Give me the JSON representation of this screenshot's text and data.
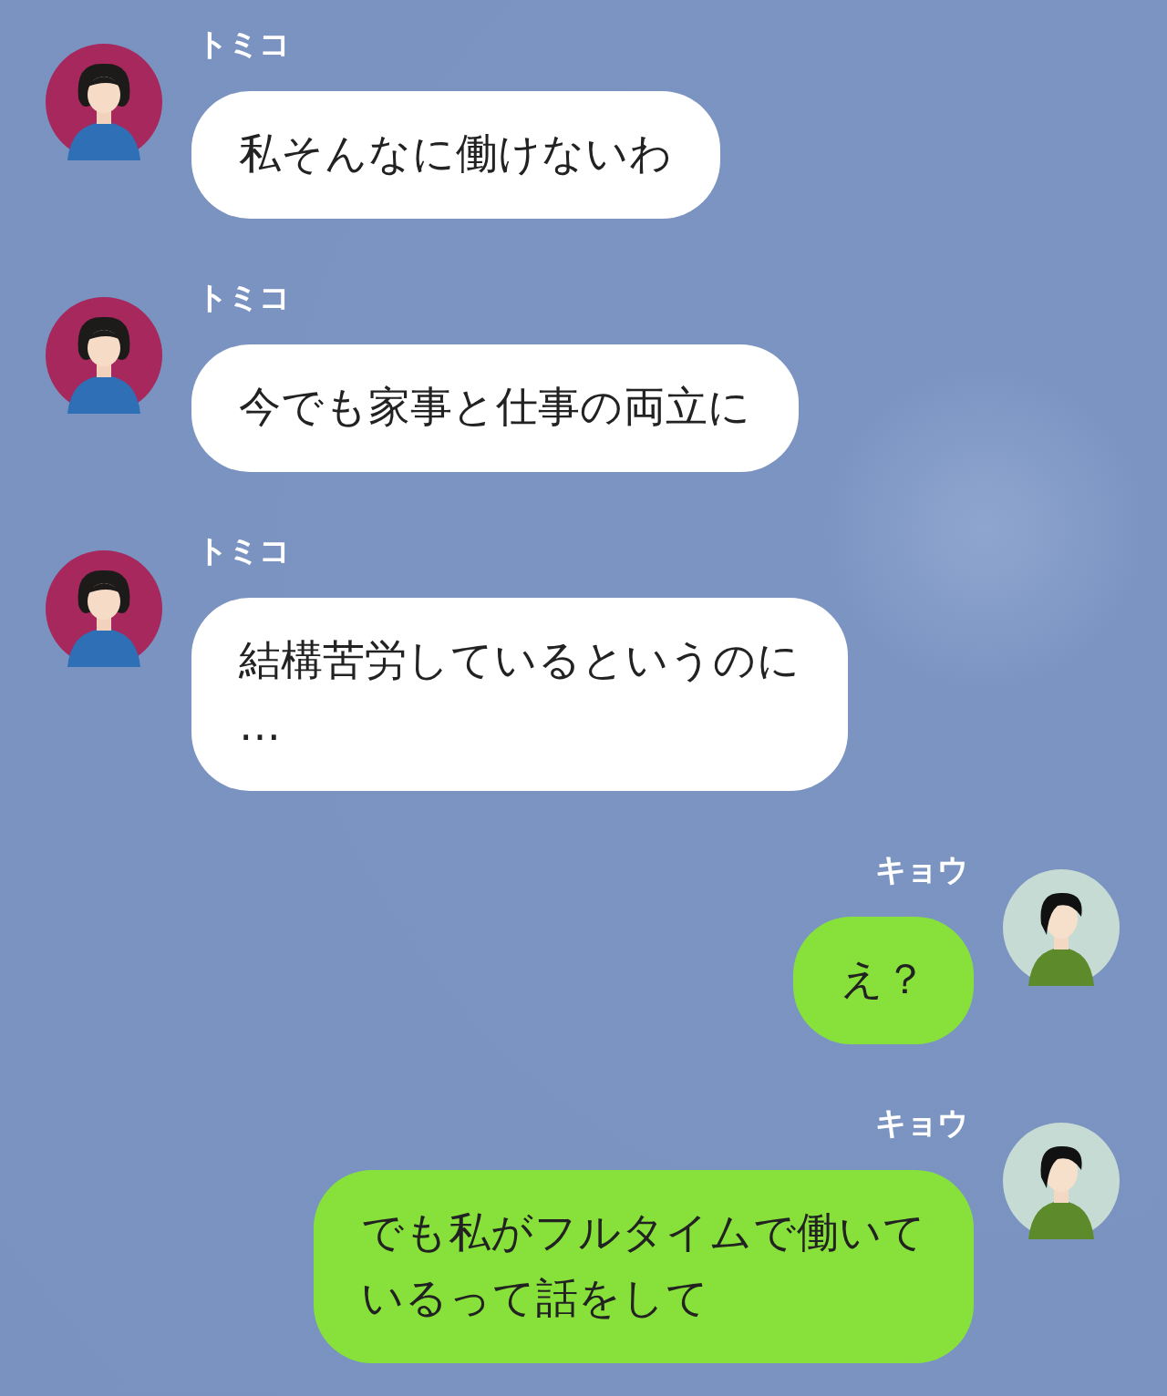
{
  "messages": [
    {
      "kind": "received",
      "sender": "トミコ",
      "lines": [
        "私そんなに働けないわ"
      ]
    },
    {
      "kind": "received",
      "sender": "トミコ",
      "lines": [
        "今でも家事と仕事の両立に"
      ]
    },
    {
      "kind": "received",
      "sender": "トミコ",
      "lines": [
        "結構苦労しているというのに",
        "…"
      ]
    },
    {
      "kind": "sent",
      "sender": "キョウ",
      "lines": [
        "え？"
      ]
    },
    {
      "kind": "sent",
      "sender": "キョウ",
      "lines": [
        "でも私がフルタイムで働いて",
        "いるって話をして"
      ]
    }
  ]
}
